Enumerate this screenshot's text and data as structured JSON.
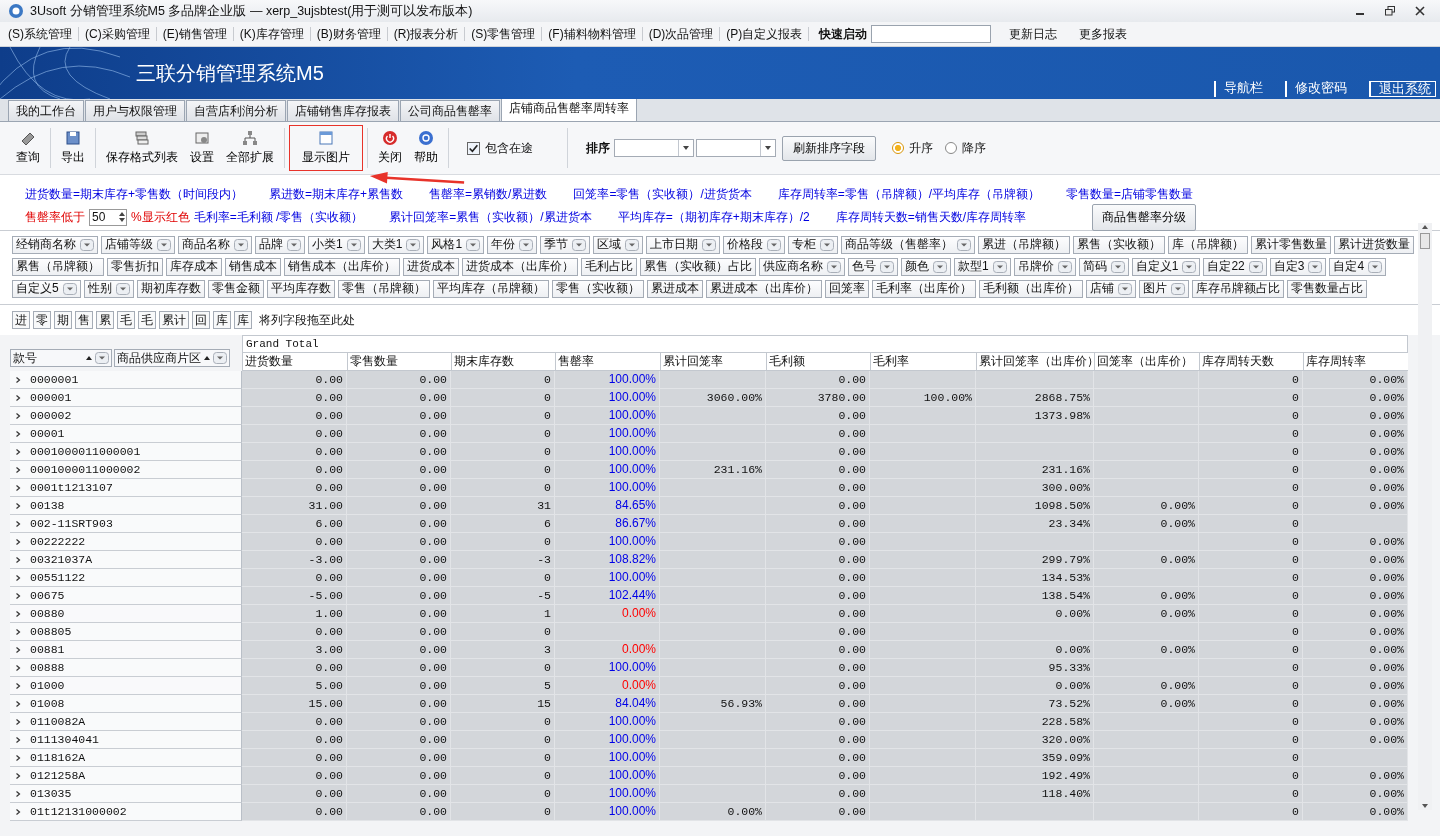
{
  "window": {
    "title": "3Usoft 分销管理系统M5 多品牌企业版 — xerp_3ujsbtest(用于测可以发布版本)"
  },
  "menu": [
    "(S)系统管理",
    "(C)采购管理",
    "(E)销售管理",
    "(K)库存管理",
    "(B)财务管理",
    "(R)报表分析",
    "(S)零售管理",
    "(F)辅料物料管理",
    "(D)次品管理",
    "(P)自定义报表"
  ],
  "quick_launch": {
    "label": "快速启动"
  },
  "menu_links": [
    "更新日志",
    "更多报表"
  ],
  "banner": {
    "title": "三联分销管理系统M5",
    "links": [
      {
        "label": "导航栏",
        "boxed": false
      },
      {
        "label": "修改密码",
        "boxed": false
      },
      {
        "label": "退出系统",
        "boxed": true
      }
    ]
  },
  "tabs": [
    {
      "label": "我的工作台",
      "selected": false
    },
    {
      "label": "用户与权限管理",
      "selected": false
    },
    {
      "label": "自营店利润分析",
      "selected": false
    },
    {
      "label": "店铺销售库存报表",
      "selected": false
    },
    {
      "label": "公司商品售罄率",
      "selected": false
    },
    {
      "label": "店铺商品售罄率周转率",
      "selected": true
    }
  ],
  "toolbar": [
    {
      "label": "查询",
      "highlighted": false
    },
    {
      "label": "导出",
      "highlighted": false
    },
    {
      "label": "保存格式列表",
      "highlighted": false
    },
    {
      "label": "设置",
      "highlighted": false
    },
    {
      "label": "全部扩展",
      "highlighted": false
    },
    {
      "label": "显示图片",
      "highlighted": true
    },
    {
      "label": "关闭",
      "highlighted": false
    },
    {
      "label": "帮助",
      "highlighted": false
    }
  ],
  "include_in_transit": {
    "label": "包含在途",
    "checked": true
  },
  "sort": {
    "label": "排序",
    "refresh_button": "刷新排序字段",
    "options": [
      {
        "label": "升序",
        "selected": true
      },
      {
        "label": "降序",
        "selected": false
      }
    ]
  },
  "formulas": [
    [
      "进货数量=期末库存+零售数（时间段内）",
      "累进数=期末库存+累售数",
      "售罄率=累销数/累进数",
      "回笼率=零售（实收额）/进货货本",
      "库存周转率=零售（吊牌额）/平均库存（吊牌额）",
      "零售数量=店铺零售数量"
    ],
    [
      "毛利率=毛利额 /零售（实收额）",
      "累计回笼率=累售（实收额）/累进货本",
      "平均库存=（期初库存+期末库存）/2",
      "库存周转天数=销售天数/库存周转率"
    ]
  ],
  "threshold": {
    "label": "售罄率低于",
    "value": "50",
    "suffix": "%显示红色"
  },
  "grade_button": "商品售罄率分级",
  "field_rows": [
    [
      {
        "label": "经销商名称",
        "filter": true
      },
      {
        "label": "店铺等级",
        "filter": true
      },
      {
        "label": "商品名称",
        "filter": true
      },
      {
        "label": "品牌",
        "filter": true
      },
      {
        "label": "小类1",
        "filter": true
      },
      {
        "label": "大类1",
        "filter": true
      },
      {
        "label": "风格1",
        "filter": true
      },
      {
        "label": "年份",
        "filter": true
      },
      {
        "label": "季节",
        "filter": true
      },
      {
        "label": "区域",
        "filter": true
      },
      {
        "label": "上市日期",
        "filter": true
      },
      {
        "label": "价格段",
        "filter": true
      },
      {
        "label": "专柜",
        "filter": true
      },
      {
        "label": "商品等级（售罄率）",
        "filter": true
      },
      {
        "label": "累进（吊牌额）",
        "filter": false
      },
      {
        "label": "累售（实收额）",
        "filter": false
      },
      {
        "label": "库（吊牌额）",
        "filter": false
      },
      {
        "label": "累计零售数量",
        "filter": false
      },
      {
        "label": "累计进货数量",
        "filter": false
      }
    ],
    [
      {
        "label": "累售（吊牌额）",
        "filter": false
      },
      {
        "label": "零售折扣",
        "filter": false
      },
      {
        "label": "库存成本",
        "filter": false
      },
      {
        "label": "销售成本",
        "filter": false
      },
      {
        "label": "销售成本（出库价）",
        "filter": false
      },
      {
        "label": "进货成本",
        "filter": false
      },
      {
        "label": "进货成本（出库价）",
        "filter": false
      },
      {
        "label": "毛利占比",
        "filter": false
      },
      {
        "label": "累售（实收额）占比",
        "filter": false
      },
      {
        "label": "供应商名称",
        "filter": true
      },
      {
        "label": "色号",
        "filter": true
      },
      {
        "label": "颜色",
        "filter": true
      },
      {
        "label": "款型1",
        "filter": true
      },
      {
        "label": "吊牌价",
        "filter": true
      },
      {
        "label": "简码",
        "filter": true
      },
      {
        "label": "自定义1",
        "filter": true
      },
      {
        "label": "自定22",
        "filter": true
      },
      {
        "label": "自定3",
        "filter": true
      },
      {
        "label": "自定4",
        "filter": true
      }
    ],
    [
      {
        "label": "自定义5",
        "filter": true
      },
      {
        "label": "性别",
        "filter": true
      },
      {
        "label": "期初库存数",
        "filter": false
      },
      {
        "label": "零售金额",
        "filter": false
      },
      {
        "label": "平均库存数",
        "filter": false
      },
      {
        "label": "零售（吊牌额）",
        "filter": false
      },
      {
        "label": "平均库存（吊牌额）",
        "filter": false
      },
      {
        "label": "零售（实收额）",
        "filter": false
      },
      {
        "label": "累进成本",
        "filter": false
      },
      {
        "label": "累进成本（出库价）",
        "filter": false
      },
      {
        "label": "回笼率",
        "filter": false
      },
      {
        "label": "毛利率（出库价）",
        "filter": false
      },
      {
        "label": "毛利额（出库价）",
        "filter": false
      },
      {
        "label": "店铺",
        "filter": true
      },
      {
        "label": "图片",
        "filter": true
      },
      {
        "label": "库存吊牌额占比",
        "filter": false
      },
      {
        "label": "零售数量占比",
        "filter": false
      }
    ]
  ],
  "data_fields": [
    "进",
    "零",
    "期",
    "售",
    "累",
    "毛",
    "毛",
    "累计",
    "回",
    "库",
    "库"
  ],
  "drop_hint": "将列字段拖至此处",
  "row_fields": [
    "款号",
    "商品供应商片区"
  ],
  "grand_total": "Grand Total",
  "columns": [
    "进货数量",
    "零售数量",
    "期末库存数",
    "售罄率",
    "累计回笼率",
    "毛利额",
    "毛利率",
    "累计回笼率（出库价）",
    "回笼率（出库价）",
    "库存周转天数",
    "库存周转率"
  ],
  "rows": [
    {
      "code": "0000001",
      "below_threshold": false,
      "cells": [
        "0.00",
        "0.00",
        "0",
        "100.00%",
        null,
        "0.00",
        null,
        null,
        null,
        "0",
        "0.00%"
      ]
    },
    {
      "code": "000001",
      "below_threshold": false,
      "cells": [
        "0.00",
        "0.00",
        "0",
        "100.00%",
        "3060.00%",
        "3780.00",
        "100.00%",
        "2868.75%",
        null,
        "0",
        "0.00%"
      ]
    },
    {
      "code": "000002",
      "below_threshold": false,
      "cells": [
        "0.00",
        "0.00",
        "0",
        "100.00%",
        null,
        "0.00",
        null,
        "1373.98%",
        null,
        "0",
        "0.00%"
      ]
    },
    {
      "code": "00001",
      "below_threshold": false,
      "cells": [
        "0.00",
        "0.00",
        "0",
        "100.00%",
        null,
        "0.00",
        null,
        null,
        null,
        "0",
        "0.00%"
      ]
    },
    {
      "code": "0001000011000001",
      "below_threshold": false,
      "cells": [
        "0.00",
        "0.00",
        "0",
        "100.00%",
        null,
        "0.00",
        null,
        null,
        null,
        "0",
        "0.00%"
      ]
    },
    {
      "code": "0001000011000002",
      "below_threshold": false,
      "cells": [
        "0.00",
        "0.00",
        "0",
        "100.00%",
        "231.16%",
        "0.00",
        null,
        "231.16%",
        null,
        "0",
        "0.00%"
      ]
    },
    {
      "code": "0001t1213107",
      "below_threshold": false,
      "cells": [
        "0.00",
        "0.00",
        "0",
        "100.00%",
        null,
        "0.00",
        null,
        "300.00%",
        null,
        "0",
        "0.00%"
      ]
    },
    {
      "code": "00138",
      "below_threshold": false,
      "cells": [
        "31.00",
        "0.00",
        "31",
        "84.65%",
        null,
        "0.00",
        null,
        "1098.50%",
        "0.00%",
        "0",
        "0.00%"
      ]
    },
    {
      "code": "002-11SRT903",
      "below_threshold": false,
      "cells": [
        "6.00",
        "0.00",
        "6",
        "86.67%",
        null,
        "0.00",
        null,
        "23.34%",
        "0.00%",
        "0",
        null
      ]
    },
    {
      "code": "00222222",
      "below_threshold": false,
      "cells": [
        "0.00",
        "0.00",
        "0",
        "100.00%",
        null,
        "0.00",
        null,
        null,
        null,
        "0",
        "0.00%"
      ]
    },
    {
      "code": "00321037A",
      "below_threshold": false,
      "cells": [
        "-3.00",
        "0.00",
        "-3",
        "108.82%",
        null,
        "0.00",
        null,
        "299.79%",
        "0.00%",
        "0",
        "0.00%"
      ]
    },
    {
      "code": "00551122",
      "below_threshold": false,
      "cells": [
        "0.00",
        "0.00",
        "0",
        "100.00%",
        null,
        "0.00",
        null,
        "134.53%",
        null,
        "0",
        "0.00%"
      ]
    },
    {
      "code": "00675",
      "below_threshold": false,
      "cells": [
        "-5.00",
        "0.00",
        "-5",
        "102.44%",
        null,
        "0.00",
        null,
        "138.54%",
        "0.00%",
        "0",
        "0.00%"
      ]
    },
    {
      "code": "00880",
      "below_threshold": true,
      "cells": [
        "1.00",
        "0.00",
        "1",
        "0.00%",
        null,
        "0.00",
        null,
        "0.00%",
        "0.00%",
        "0",
        "0.00%"
      ]
    },
    {
      "code": "008805",
      "cells": [
        "0.00",
        "0.00",
        "0",
        null,
        null,
        "0.00",
        null,
        null,
        null,
        "0",
        "0.00%"
      ]
    },
    {
      "code": "00881",
      "below_threshold": true,
      "cells": [
        "3.00",
        "0.00",
        "3",
        "0.00%",
        null,
        "0.00",
        null,
        "0.00%",
        "0.00%",
        "0",
        "0.00%"
      ]
    },
    {
      "code": "00888",
      "below_threshold": false,
      "cells": [
        "0.00",
        "0.00",
        "0",
        "100.00%",
        null,
        "0.00",
        null,
        "95.33%",
        null,
        "0",
        "0.00%"
      ]
    },
    {
      "code": "01000",
      "below_threshold": true,
      "cells": [
        "5.00",
        "0.00",
        "5",
        "0.00%",
        null,
        "0.00",
        null,
        "0.00%",
        "0.00%",
        "0",
        "0.00%"
      ]
    },
    {
      "code": "01008",
      "below_threshold": false,
      "cells": [
        "15.00",
        "0.00",
        "15",
        "84.04%",
        "56.93%",
        "0.00",
        null,
        "73.52%",
        "0.00%",
        "0",
        "0.00%"
      ]
    },
    {
      "code": "0110082A",
      "below_threshold": false,
      "cells": [
        "0.00",
        "0.00",
        "0",
        "100.00%",
        null,
        "0.00",
        null,
        "228.58%",
        null,
        "0",
        "0.00%"
      ]
    },
    {
      "code": "0111304041",
      "below_threshold": false,
      "cells": [
        "0.00",
        "0.00",
        "0",
        "100.00%",
        null,
        "0.00",
        null,
        "320.00%",
        null,
        "0",
        "0.00%"
      ]
    },
    {
      "code": "0118162A",
      "below_threshold": false,
      "cells": [
        "0.00",
        "0.00",
        "0",
        "100.00%",
        null,
        "0.00",
        null,
        "359.09%",
        null,
        "0",
        null
      ]
    },
    {
      "code": "0121258A",
      "below_threshold": false,
      "cells": [
        "0.00",
        "0.00",
        "0",
        "100.00%",
        null,
        "0.00",
        null,
        "192.49%",
        null,
        "0",
        "0.00%"
      ]
    },
    {
      "code": "013035",
      "below_threshold": false,
      "cells": [
        "0.00",
        "0.00",
        "0",
        "100.00%",
        null,
        "0.00",
        null,
        "118.40%",
        null,
        "0",
        "0.00%"
      ]
    },
    {
      "code": "01t12131000002",
      "below_threshold": false,
      "cells": [
        "0.00",
        "0.00",
        "0",
        "100.00%",
        "0.00%",
        "0.00",
        null,
        null,
        null,
        "0",
        "0.00%"
      ]
    }
  ]
}
